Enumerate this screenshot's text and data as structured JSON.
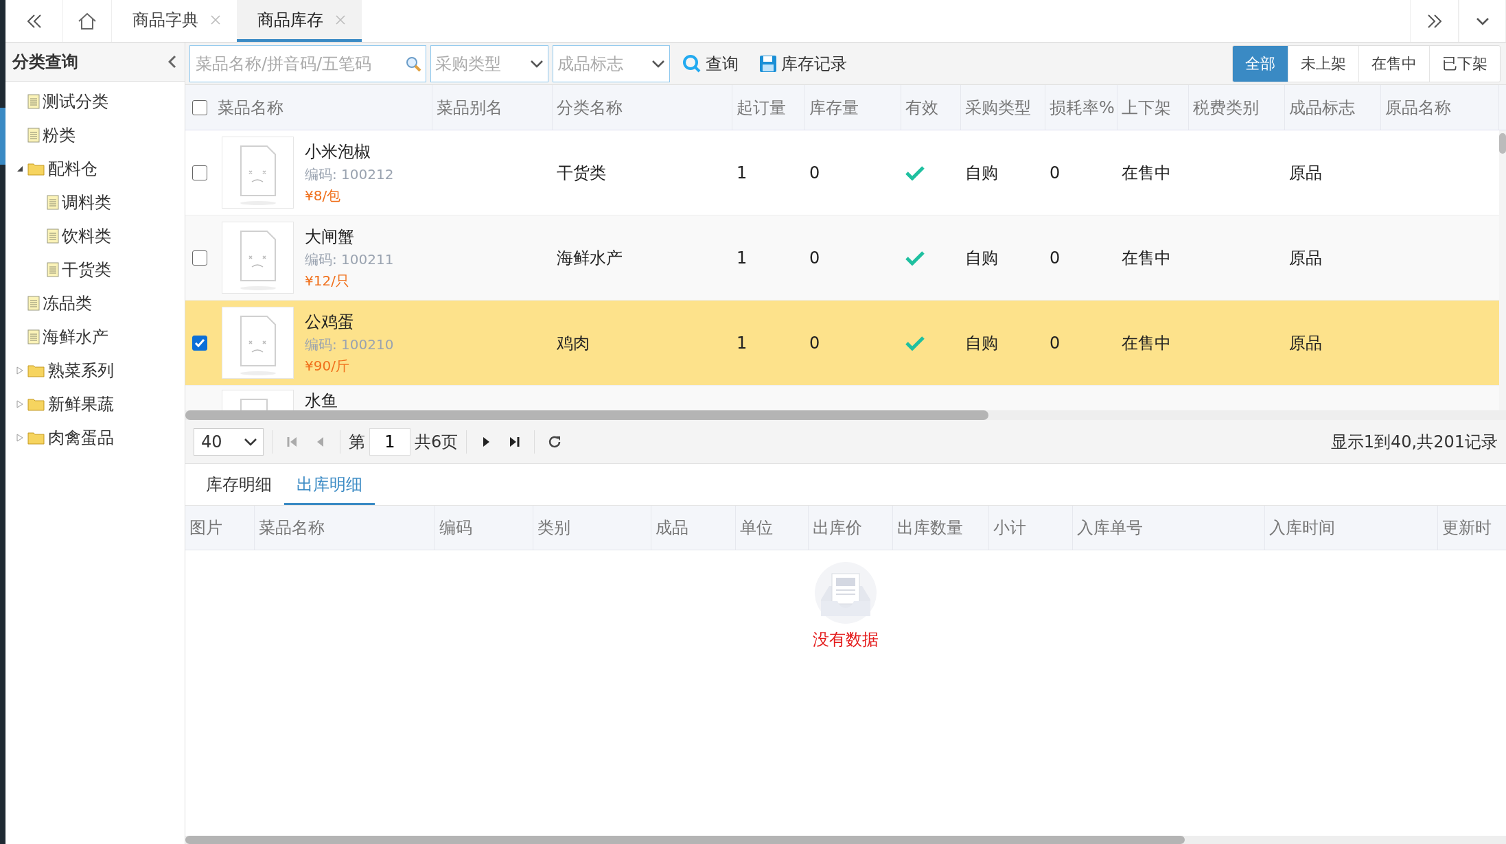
{
  "top_tabs": [
    {
      "label": "商品字典",
      "selected": false,
      "closable": true
    },
    {
      "label": "商品库存",
      "selected": true,
      "closable": true
    }
  ],
  "sidebar": {
    "title": "分类查询",
    "items": [
      {
        "label": "测试分类",
        "kind": "file"
      },
      {
        "label": "粉类",
        "kind": "file"
      },
      {
        "label": "配料仓",
        "kind": "folder",
        "expanded": true,
        "children": [
          {
            "label": "调料类",
            "kind": "file"
          },
          {
            "label": "饮料类",
            "kind": "file"
          },
          {
            "label": "干货类",
            "kind": "file"
          }
        ]
      },
      {
        "label": "冻品类",
        "kind": "file"
      },
      {
        "label": "海鲜水产",
        "kind": "file"
      },
      {
        "label": "熟菜系列",
        "kind": "folder",
        "expanded": false
      },
      {
        "label": "新鲜果蔬",
        "kind": "folder",
        "expanded": false
      },
      {
        "label": "肉禽蛋品",
        "kind": "folder",
        "expanded": false
      }
    ]
  },
  "toolbar": {
    "search": {
      "placeholder": "菜品名称/拼音码/五笔码"
    },
    "selects": [
      {
        "placeholder": "采购类型"
      },
      {
        "placeholder": "成品标志"
      }
    ],
    "buttons": [
      {
        "label": "查询",
        "kind": "search"
      },
      {
        "label": "库存记录",
        "kind": "save"
      }
    ],
    "filters": [
      {
        "label": "全部",
        "selected": true
      },
      {
        "label": "未上架",
        "selected": false
      },
      {
        "label": "在售中",
        "selected": false
      },
      {
        "label": "已下架",
        "selected": false
      }
    ]
  },
  "table": {
    "all_checked": false,
    "columns": [
      "菜品名称",
      "菜品别名",
      "分类名称",
      "起订量",
      "库存量",
      "有效",
      "采购类型",
      "损耗率%",
      "上下架",
      "税费类别",
      "成品标志",
      "原品名称"
    ],
    "rows": [
      {
        "kind": "full",
        "selected": false,
        "name": "小米泡椒",
        "code": "编码: 100212",
        "price": "¥8/包",
        "category": "干货类",
        "min_order": "1",
        "stock": "0",
        "valid": true,
        "purchase": "自购",
        "loss": "0",
        "shelf": "在售中",
        "finished": "原品"
      },
      {
        "kind": "full",
        "selected": false,
        "name": "大闸蟹",
        "code": "编码: 100211",
        "price": "¥12/只",
        "category": "海鲜水产",
        "min_order": "1",
        "stock": "0",
        "valid": true,
        "purchase": "自购",
        "loss": "0",
        "shelf": "在售中",
        "finished": "原品"
      },
      {
        "kind": "full",
        "selected": true,
        "name": "公鸡蛋",
        "code": "编码: 100210",
        "price": "¥90/斤",
        "category": "鸡肉",
        "min_order": "1",
        "stock": "0",
        "valid": true,
        "purchase": "自购",
        "loss": "0",
        "shelf": "在售中",
        "finished": "原品"
      },
      {
        "kind": "partial",
        "name": "水鱼"
      }
    ]
  },
  "pager": {
    "page_size": "40",
    "page_prefix": "第",
    "page": "1",
    "page_suffix": "共6页",
    "summary": "显示1到40,共201记录"
  },
  "detail_tabs": [
    {
      "label": "库存明细",
      "selected": false
    },
    {
      "label": "出库明细",
      "selected": true
    }
  ],
  "detail_table": {
    "columns": [
      "图片",
      "菜品名称",
      "编码",
      "类别",
      "成品",
      "单位",
      "出库价",
      "出库数量",
      "小计",
      "入库单号",
      "入库时间",
      "更新时"
    ],
    "empty_text": "没有数据"
  }
}
